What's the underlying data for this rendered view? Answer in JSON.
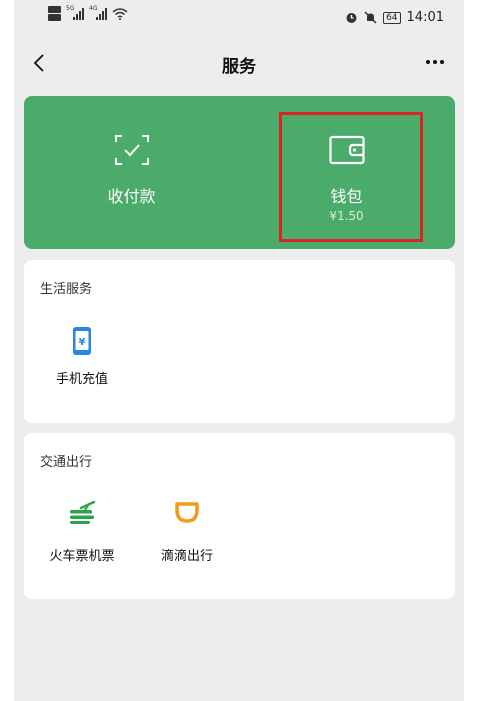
{
  "status_bar": {
    "time": "14:01",
    "battery": "64",
    "sim1_net": "5G",
    "sim2_net": "4G"
  },
  "nav": {
    "title": "服务",
    "back_icon": "chevron-left-icon",
    "more_icon": "more-icon"
  },
  "green_card": {
    "color": "#4aab6b",
    "pay": {
      "label": "收付款",
      "icon": "scan-check-icon"
    },
    "wallet": {
      "label": "钱包",
      "balance": "¥1.50",
      "icon": "wallet-icon"
    },
    "highlight_color": "#dd2424"
  },
  "sections": {
    "life": {
      "title": "生活服务",
      "items": [
        {
          "label": "手机充值",
          "icon": "phone-recharge-icon"
        }
      ]
    },
    "transport": {
      "title": "交通出行",
      "items": [
        {
          "label": "火车票机票",
          "icon": "train-plane-icon"
        },
        {
          "label": "滴滴出行",
          "icon": "didi-icon"
        }
      ]
    }
  }
}
